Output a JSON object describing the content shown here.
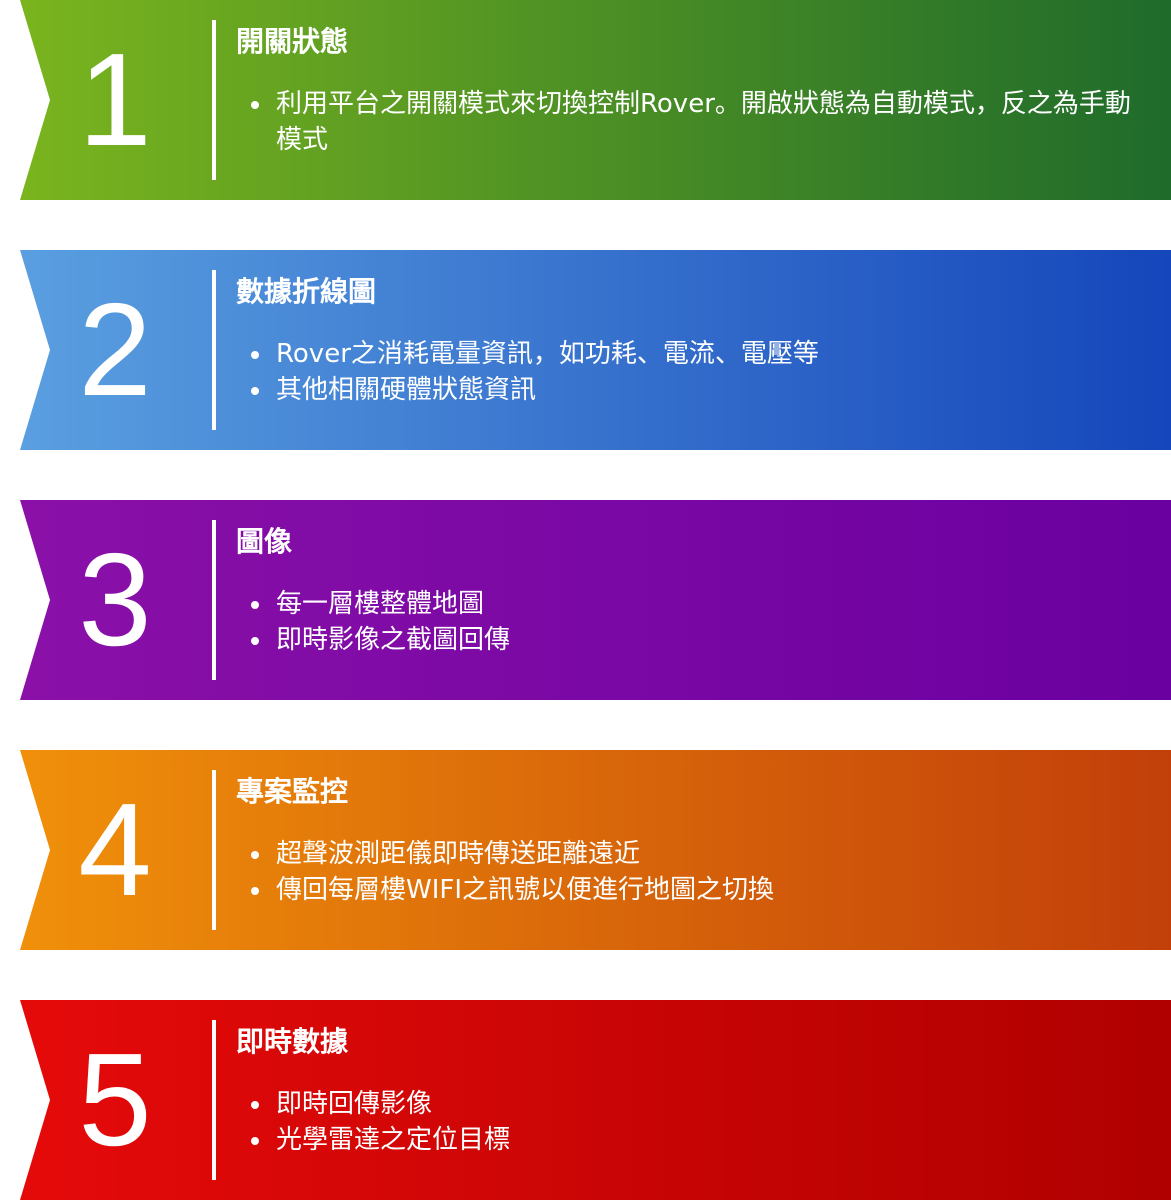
{
  "bands": [
    {
      "number": "1",
      "title": "開關狀態",
      "bullets": [
        "利用平台之開關模式來切換控制Rover。開啟狀態為自動模式，反之為手動模式"
      ],
      "color_start": "#7ab41e",
      "color_end": "#1f6b2b"
    },
    {
      "number": "2",
      "title": "數據折線圖",
      "bullets": [
        "Rover之消耗電量資訊，如功耗、電流、電壓等",
        "其他相關硬體狀態資訊"
      ],
      "color_start": "#5a9fe0",
      "color_end": "#1546bb"
    },
    {
      "number": "3",
      "title": "圖像",
      "bullets": [
        "每一層樓整體地圖",
        "即時影像之截圖回傳"
      ],
      "color_start": "#8a10a8",
      "color_end": "#6a00a0"
    },
    {
      "number": "4",
      "title": "專案監控",
      "bullets": [
        "超聲波測距儀即時傳送距離遠近",
        "傳回每層樓WIFI之訊號以便進行地圖之切換"
      ],
      "color_start": "#f0900a",
      "color_end": "#c23f0a"
    },
    {
      "number": "5",
      "title": "即時數據",
      "bullets": [
        "即時回傳影像",
        "光學雷達之定位目標"
      ],
      "color_start": "#e50a0a",
      "color_end": "#b00000"
    }
  ]
}
